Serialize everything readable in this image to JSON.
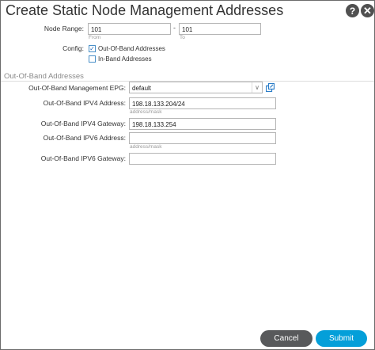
{
  "dialog": {
    "title": "Create Static Node Management Addresses",
    "help_label": "?",
    "close_label": "✕"
  },
  "node_range": {
    "label": "Node Range:",
    "from_value": "101",
    "from_sublabel": "From",
    "separator": "-",
    "to_value": "101",
    "to_sublabel": "To"
  },
  "config": {
    "label": "Config:",
    "options": [
      {
        "label": "Out-Of-Band Addresses",
        "checked": true
      },
      {
        "label": "In-Band Addresses",
        "checked": false
      }
    ]
  },
  "oob_section": {
    "title": "Out-Of-Band Addresses",
    "epg_label": "Out-Of-Band Management EPG:",
    "epg_value": "default",
    "ipv4_address_label": "Out-Of-Band IPV4 Address:",
    "ipv4_address_value": "198.18.133.204/24",
    "ipv4_address_hint": "address/mask",
    "ipv4_gateway_label": "Out-Of-Band IPV4 Gateway:",
    "ipv4_gateway_value": "198.18.133.254",
    "ipv6_address_label": "Out-Of-Band IPV6 Address:",
    "ipv6_address_value": "",
    "ipv6_address_hint": "address/mask",
    "ipv6_gateway_label": "Out-Of-Band IPV6 Gateway:",
    "ipv6_gateway_value": ""
  },
  "footer": {
    "cancel_label": "Cancel",
    "submit_label": "Submit"
  },
  "colors": {
    "accent": "#049fd9",
    "cancel": "#58595b",
    "checkbox": "#4a90c8"
  }
}
